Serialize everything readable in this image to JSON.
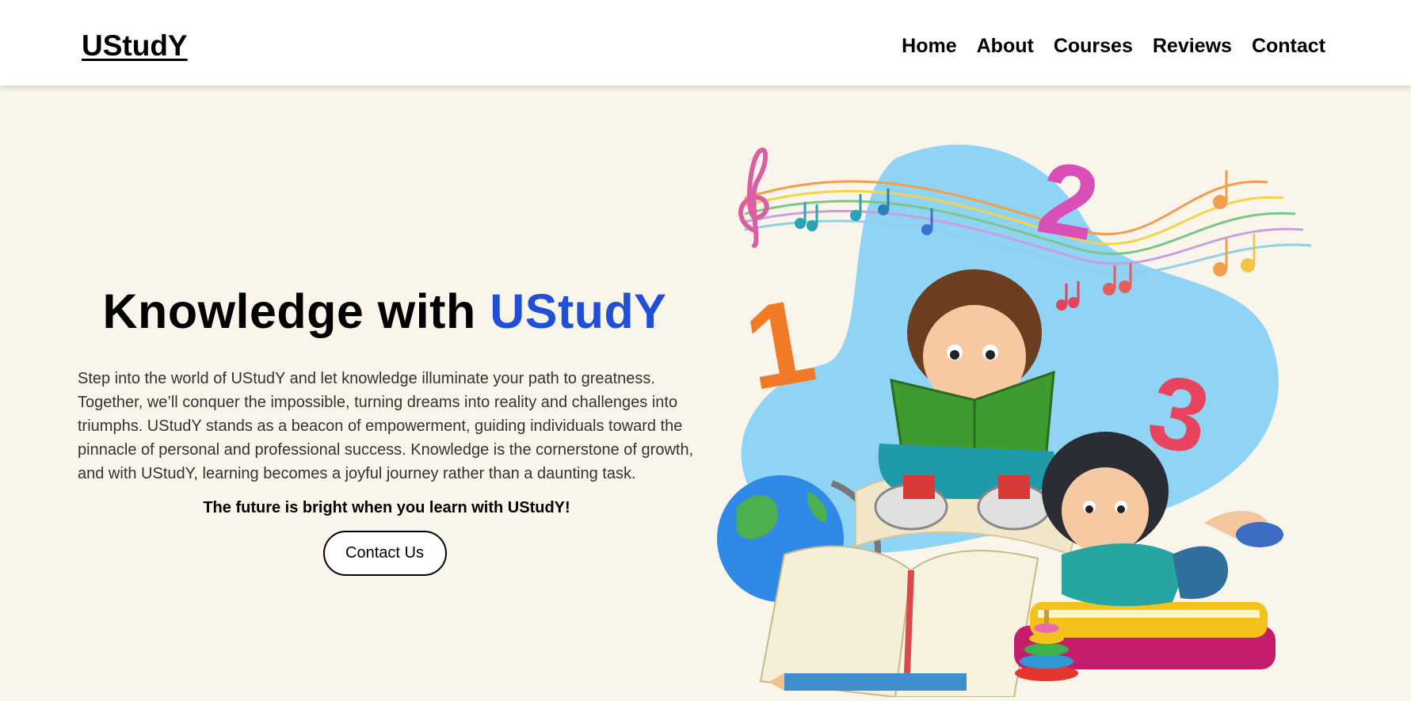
{
  "header": {
    "logo": "UStudY",
    "nav": [
      "Home",
      "About",
      "Courses",
      "Reviews",
      "Contact"
    ]
  },
  "hero": {
    "title_prefix": "Knowledge with",
    "title_brand": "UStudY",
    "paragraph": "Step into the world of UStudY and let knowledge illuminate your path to greatness. Together, we’ll conquer the impossible, turning dreams into reality and challenges into triumphs. UStudY stands as a beacon of empowerment, guiding individuals toward the pinnacle of personal and professional success. Knowledge is the cornerstone of growth, and with UStudY, learning becomes a joyful journey rather than a daunting task.",
    "tagline": "The future is bright when you learn with UStudY!",
    "cta_label": "Contact Us"
  },
  "illustration": {
    "numbers": [
      "1",
      "2",
      "3"
    ]
  },
  "colors": {
    "background": "#faf5eb",
    "brand": "#1f4fd6",
    "blob": "#8fd3f5"
  }
}
